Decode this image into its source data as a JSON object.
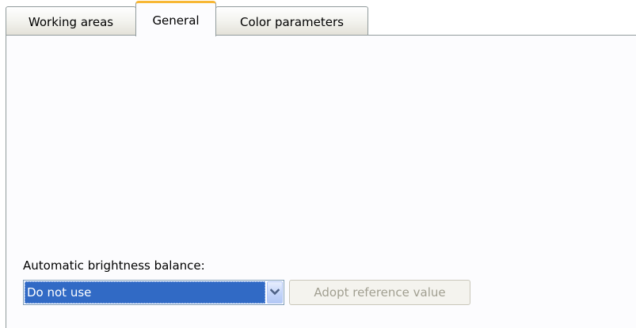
{
  "tabs": [
    {
      "label": "Working areas",
      "selected": false
    },
    {
      "label": "General",
      "selected": true
    },
    {
      "label": "Color parameters",
      "selected": false
    }
  ],
  "general": {
    "brightness_label": "Automatic brightness balance:",
    "brightness_select": {
      "value": "Do not use",
      "icon": "chevron-down-icon"
    },
    "adopt_button": {
      "label": "Adopt reference value",
      "enabled": false
    }
  },
  "colors": {
    "selection": "#316ac5",
    "active_tab_accent": "#f7b735",
    "disabled_text": "#a19f91",
    "border": "#919b9c"
  }
}
